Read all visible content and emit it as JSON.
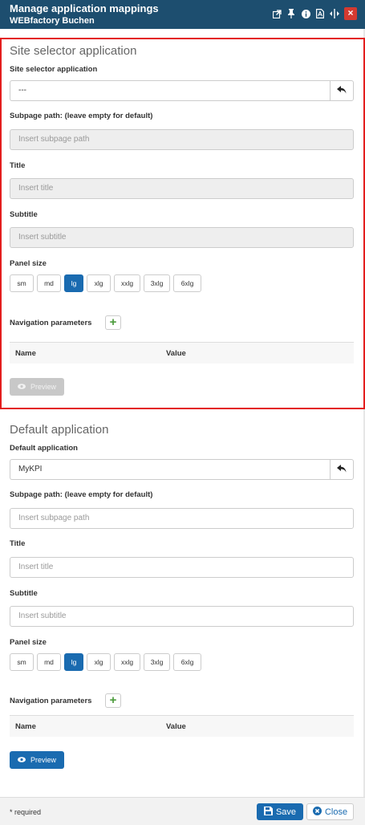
{
  "titlebar": {
    "title": "Manage application mappings",
    "subtitle": "WEBfactory Buchen",
    "icons": [
      "external-link-icon",
      "pin-icon",
      "info-icon",
      "pdf-icon",
      "resize-horizontal-icon",
      "close-icon"
    ],
    "close_glyph": "×"
  },
  "site_selector": {
    "section_title": "Site selector application",
    "app_label": "Site selector application",
    "app_value": "---",
    "subpage_label": "Subpage path: (leave empty for default)",
    "subpage_placeholder": "Insert subpage path",
    "title_label": "Title",
    "title_placeholder": "Insert title",
    "subtitle_label": "Subtitle",
    "subtitle_placeholder": "Insert subtitle",
    "panel_size_label": "Panel size",
    "sizes": [
      "sm",
      "md",
      "lg",
      "xlg",
      "xxlg",
      "3xlg",
      "6xlg"
    ],
    "active_size": "lg",
    "nav_params_label": "Navigation parameters",
    "add_glyph": "+",
    "col_name": "Name",
    "col_value": "Value",
    "preview_label": "Preview",
    "preview_enabled": false
  },
  "default_app": {
    "section_title": "Default application",
    "app_label": "Default application",
    "app_value": "MyKPI",
    "subpage_label": "Subpage path: (leave empty for default)",
    "subpage_placeholder": "Insert subpage path",
    "title_label": "Title",
    "title_placeholder": "Insert title",
    "subtitle_label": "Subtitle",
    "subtitle_placeholder": "Insert subtitle",
    "panel_size_label": "Panel size",
    "sizes": [
      "sm",
      "md",
      "lg",
      "xlg",
      "xxlg",
      "3xlg",
      "6xlg"
    ],
    "active_size": "lg",
    "nav_params_label": "Navigation parameters",
    "add_glyph": "+",
    "col_name": "Name",
    "col_value": "Value",
    "preview_label": "Preview",
    "preview_enabled": true
  },
  "footer": {
    "required_note": "* required",
    "save_label": "Save",
    "close_label": "Close"
  },
  "colors": {
    "header_bg": "#1d4e6f",
    "primary": "#1a6bb0",
    "highlight_border": "#e31d1d",
    "close_red": "#d43a30"
  }
}
